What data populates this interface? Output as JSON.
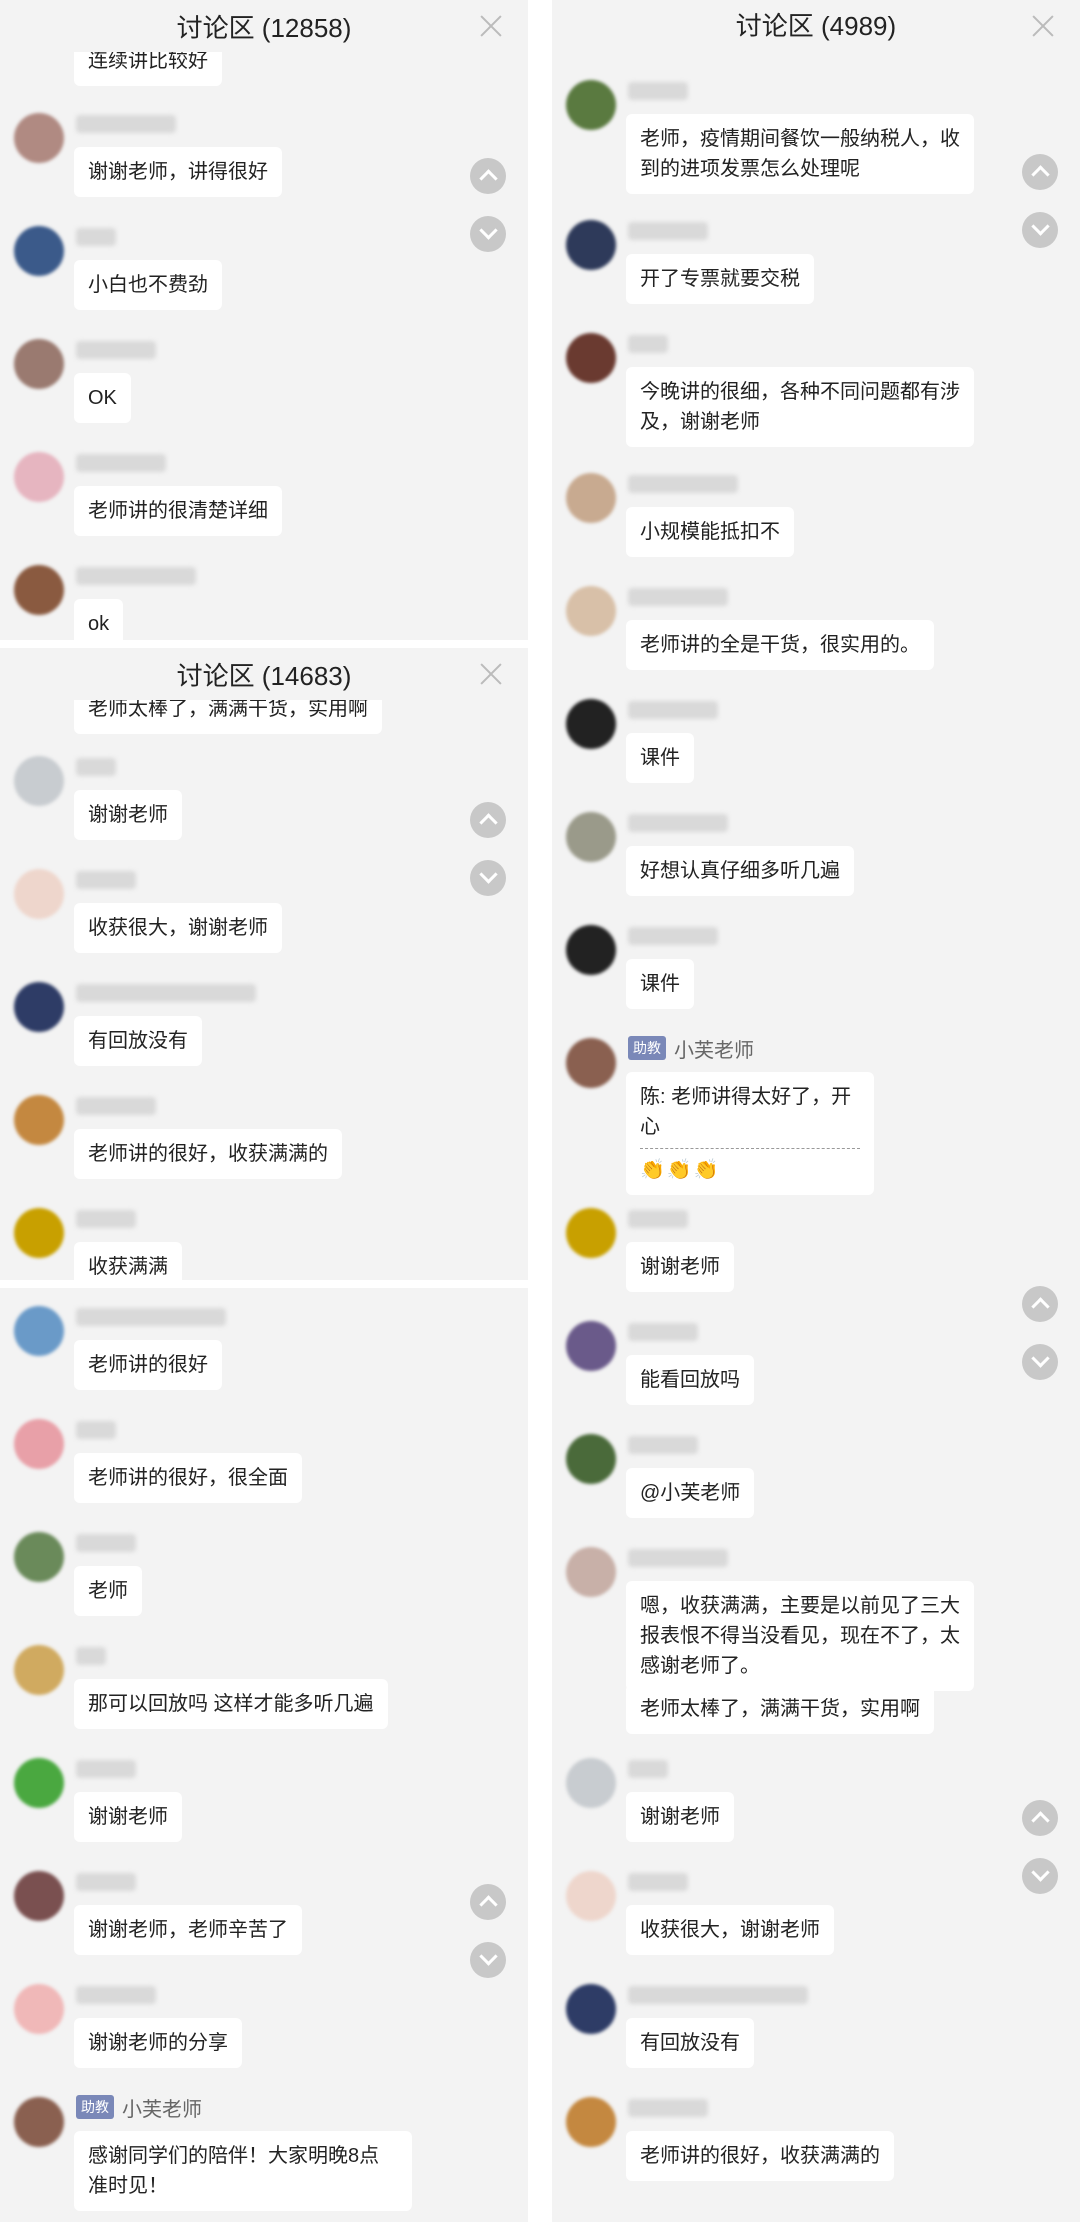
{
  "panels": {
    "p1": {
      "title": "讨论区 (12858)",
      "top_snippet": "连续讲比较好",
      "messages": [
        {
          "text": "谢谢老师，讲得很好"
        },
        {
          "text": "小白也不费劲"
        },
        {
          "text": "OK"
        },
        {
          "text": "老师讲的很清楚详细"
        },
        {
          "text": "ok"
        }
      ]
    },
    "p2": {
      "title": "讨论区 (14683)",
      "top_snippet": "老师太棒了，满满干货，实用啊",
      "messages": [
        {
          "text": "谢谢老师"
        },
        {
          "text": "收获很大，谢谢老师"
        },
        {
          "text": "有回放没有"
        },
        {
          "text": "老师讲的很好，收获满满的"
        },
        {
          "text": "收获满满"
        }
      ]
    },
    "p3": {
      "messages": [
        {
          "text": "老师讲的很好"
        },
        {
          "text": "老师讲的很好，很全面"
        },
        {
          "text": "老师"
        },
        {
          "text": "那可以回放吗 这样才能多听几遍"
        },
        {
          "text": "谢谢老师"
        },
        {
          "text": "谢谢老师，老师辛苦了"
        },
        {
          "text": "谢谢老师的分享"
        },
        {
          "badge": "助教",
          "name": "小芙老师",
          "text": "感谢同学们的陪伴！大家明晚8点准时见！"
        }
      ]
    },
    "p4": {
      "title": "讨论区 (4989)",
      "messages": [
        {
          "text": "老师，疫情期间餐饮一般纳税人，收到的进项发票怎么处理呢"
        },
        {
          "text": "开了专票就要交税"
        },
        {
          "text": "今晚讲的很细，各种不同问题都有涉及，谢谢老师"
        },
        {
          "text": "小规模能抵扣不"
        },
        {
          "text": "老师讲的全是干货，很实用的。"
        },
        {
          "text": "课件"
        },
        {
          "text": "好想认真仔细多听几遍"
        },
        {
          "text": "课件"
        },
        {
          "badge": "助教",
          "name": "小芙老师",
          "text": "陈: 老师讲得太好了，开心",
          "emoji": "👏👏👏"
        },
        {
          "text": "谢谢老师"
        },
        {
          "text": "能看回放吗"
        },
        {
          "text": "@小芙老师"
        },
        {
          "text": "嗯，收获满满，主要是以前见了三大报表恨不得当没看见，现在不了，太感谢老师了。"
        },
        {
          "text": "老师太棒了，满满干货，实用啊"
        },
        {
          "text": "谢谢老师"
        },
        {
          "text": "收获很大，谢谢老师"
        },
        {
          "text": "有回放没有"
        },
        {
          "text": "老师讲的很好，收获满满的"
        }
      ]
    }
  },
  "colors": {
    "background": "#f3f3f3",
    "bubble": "#ffffff",
    "badge": "#7a88b8",
    "scroll_button": "#c8c8c8"
  },
  "icons": [
    "close-icon",
    "chevron-up-icon",
    "chevron-down-icon"
  ]
}
